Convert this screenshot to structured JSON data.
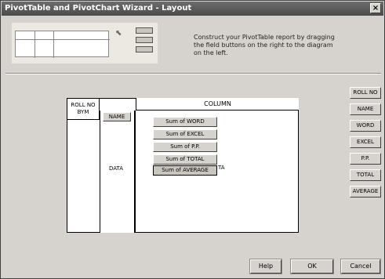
{
  "window": {
    "title": "PivotTable and PivotChart Wizard - Layout",
    "close_label": "×"
  },
  "instructions": "Construct your PivotTable report by dragging the field buttons on the right to the diagram on the left.",
  "layout": {
    "page_label": "ROLL NO",
    "page_sub": "BYM",
    "column_label": "COLUMN",
    "row_label": "NAME",
    "data_label": "DATA",
    "data_tail": "TA",
    "data_fields": [
      "Sum of WORD",
      "Sum of EXCEL",
      "Sum of P.P.",
      "Sum of TOTAL",
      "Sum of AVERAGE"
    ]
  },
  "fields": [
    "ROLL NO",
    "NAME",
    "WORD",
    "EXCEL",
    "P.P.",
    "TOTAL",
    "AVERAGE"
  ],
  "buttons": {
    "help": "Help",
    "ok": "OK",
    "cancel": "Cancel"
  }
}
